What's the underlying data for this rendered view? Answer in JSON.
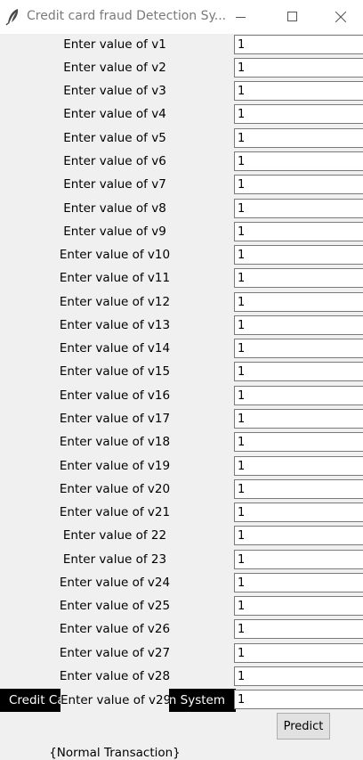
{
  "window": {
    "title": "Credit card fraud Detection Sy...",
    "icon": "feather-icon",
    "controls": [
      "minimize-icon",
      "maximize-icon",
      "close-icon"
    ]
  },
  "fields": [
    {
      "label": "Enter value of v1",
      "value": "1"
    },
    {
      "label": "Enter value of v2",
      "value": "1"
    },
    {
      "label": "Enter value of v3",
      "value": "1"
    },
    {
      "label": "Enter value of v4",
      "value": "1"
    },
    {
      "label": "Enter value of v5",
      "value": "1"
    },
    {
      "label": "Enter value of v6",
      "value": "1"
    },
    {
      "label": "Enter value of v7",
      "value": "1"
    },
    {
      "label": "Enter value of v8",
      "value": "1"
    },
    {
      "label": "Enter value of v9",
      "value": "1"
    },
    {
      "label": "Enter value of v10",
      "value": "1"
    },
    {
      "label": "Enter value of v11",
      "value": "1"
    },
    {
      "label": "Enter value of v12",
      "value": "1"
    },
    {
      "label": "Enter value of v13",
      "value": "1"
    },
    {
      "label": "Enter value of v14",
      "value": "1"
    },
    {
      "label": "Enter value of v15",
      "value": "1"
    },
    {
      "label": "Enter value of v16",
      "value": "1"
    },
    {
      "label": "Enter value of v17",
      "value": "1"
    },
    {
      "label": "Enter value of v18",
      "value": "1"
    },
    {
      "label": "Enter value of v19",
      "value": "1"
    },
    {
      "label": "Enter value of v20",
      "value": "1"
    },
    {
      "label": "Enter value of v21",
      "value": "1"
    },
    {
      "label": "Enter value of 22",
      "value": "1"
    },
    {
      "label": "Enter value of 23",
      "value": "1"
    },
    {
      "label": "Enter value of v24",
      "value": "1"
    },
    {
      "label": "Enter value of v25",
      "value": "1"
    },
    {
      "label": "Enter value of v26",
      "value": "1"
    },
    {
      "label": "Enter value of v27",
      "value": "1"
    },
    {
      "label": "Enter value of v28",
      "value": "1"
    },
    {
      "label": "Enter value of v29",
      "value": "1"
    }
  ],
  "banner": {
    "text": "Credit Card Fraud Detection System",
    "background": "#000000",
    "color": "#ffffff"
  },
  "predict_button": {
    "label": "Predict"
  },
  "result": {
    "text": "{Normal Transaction}"
  }
}
